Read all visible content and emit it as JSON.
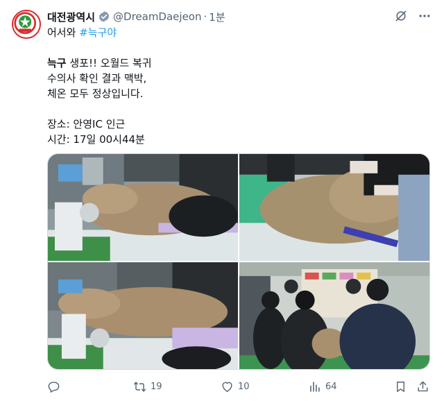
{
  "author": {
    "display_name": "대전광역시",
    "handle": "@DreamDaejeon",
    "separator": "·",
    "time": "1분",
    "avatar_label": "대전광역시"
  },
  "tweet": {
    "line1_prefix": "어서와 ",
    "line1_hashtag": "#늑구야",
    "line2_bold": "늑구",
    "line2_rest": " 생포!! 오월드 복귀",
    "line3": "수의사 확인 결과 맥박,",
    "line4": "체온 모두 정상입니다.",
    "line5": "장소: 안영IC 인근",
    "line6": "시간: 17일 00시44분"
  },
  "media": {
    "count": 4
  },
  "stats": {
    "replies": "",
    "retweets": "19",
    "likes": "10",
    "views": "64"
  },
  "colors": {
    "link": "#1d9bf0",
    "text": "#0f1419",
    "secondary": "#536471",
    "verified_badge": "#829aab",
    "avatar_red": "#d92d2d",
    "avatar_green": "#2c9b3f"
  }
}
